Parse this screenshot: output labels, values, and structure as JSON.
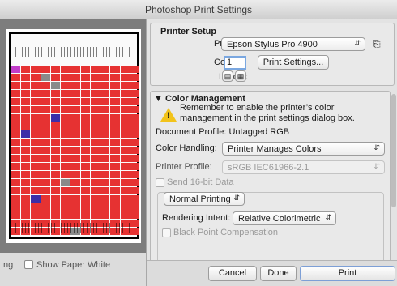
{
  "window": {
    "title": "Photoshop Print Settings"
  },
  "preview": {
    "show_paper_white_label": "Show Paper White",
    "partial_label": "ng"
  },
  "printer_setup": {
    "heading": "Printer Setup",
    "printer_label": "Printer:",
    "printer_value": "Epson Stylus Pro 4900",
    "copies_label": "Copies:",
    "copies_value": "1",
    "print_settings_button": "Print Settings...",
    "layout_label": "Layout:"
  },
  "color_management": {
    "heading": "Color Management",
    "warning_text_line1": "Remember to enable the printer’s color",
    "warning_text_line2": "management in the print settings dialog box.",
    "document_profile": "Document Profile: Untagged RGB",
    "color_handling_label": "Color Handling:",
    "color_handling_value": "Printer Manages Colors",
    "printer_profile_label": "Printer Profile:",
    "printer_profile_value": "sRGB IEC61966-2.1",
    "send_16bit_label": "Send 16-bit Data",
    "normal_printing_value": "Normal Printing",
    "rendering_intent_label": "Rendering Intent:",
    "rendering_intent_value": "Relative Colorimetric",
    "black_point_label": "Black Point Compensation"
  },
  "actions": {
    "cancel": "Cancel",
    "done": "Done",
    "print": "Print"
  },
  "colors": {
    "warning": "#f2c31a",
    "focus": "#7aa7e0"
  }
}
